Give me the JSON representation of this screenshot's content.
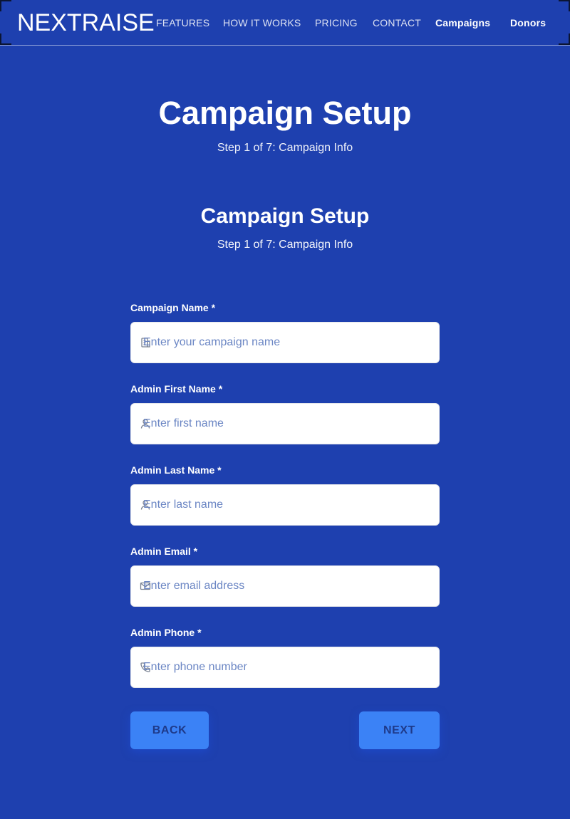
{
  "nav": {
    "logo": "NEXTRAISE",
    "links": [
      "FEATURES",
      "HOW IT WORKS",
      "PRICING",
      "CONTACT"
    ],
    "app_links": [
      "Campaigns",
      "Donors"
    ]
  },
  "hero": {
    "title": "Campaign Setup",
    "subtitle": "Step 1 of 7: Campaign Info"
  },
  "form_header": {
    "title": "Campaign Setup",
    "subtitle": "Step 1 of 7: Campaign Info"
  },
  "form": {
    "fields": [
      {
        "label": "Campaign Name *",
        "placeholder": "Enter your campaign name",
        "value": "",
        "icon": "building-icon"
      },
      {
        "label": "Admin First Name *",
        "placeholder": "Enter first name",
        "value": "",
        "icon": "user-icon"
      },
      {
        "label": "Admin Last Name *",
        "placeholder": "Enter last name",
        "value": "",
        "icon": "user-icon"
      },
      {
        "label": "Admin Email *",
        "placeholder": "Enter email address",
        "value": "",
        "icon": "envelope-icon"
      },
      {
        "label": "Admin Phone *",
        "placeholder": "Enter phone number",
        "value": "",
        "icon": "phone-icon"
      }
    ],
    "back_label": "BACK",
    "next_label": "NEXT"
  },
  "colors": {
    "background": "#1e40af",
    "button": "#3b82f6",
    "button_text": "#1e3a8a",
    "placeholder": "#6b86c4"
  }
}
